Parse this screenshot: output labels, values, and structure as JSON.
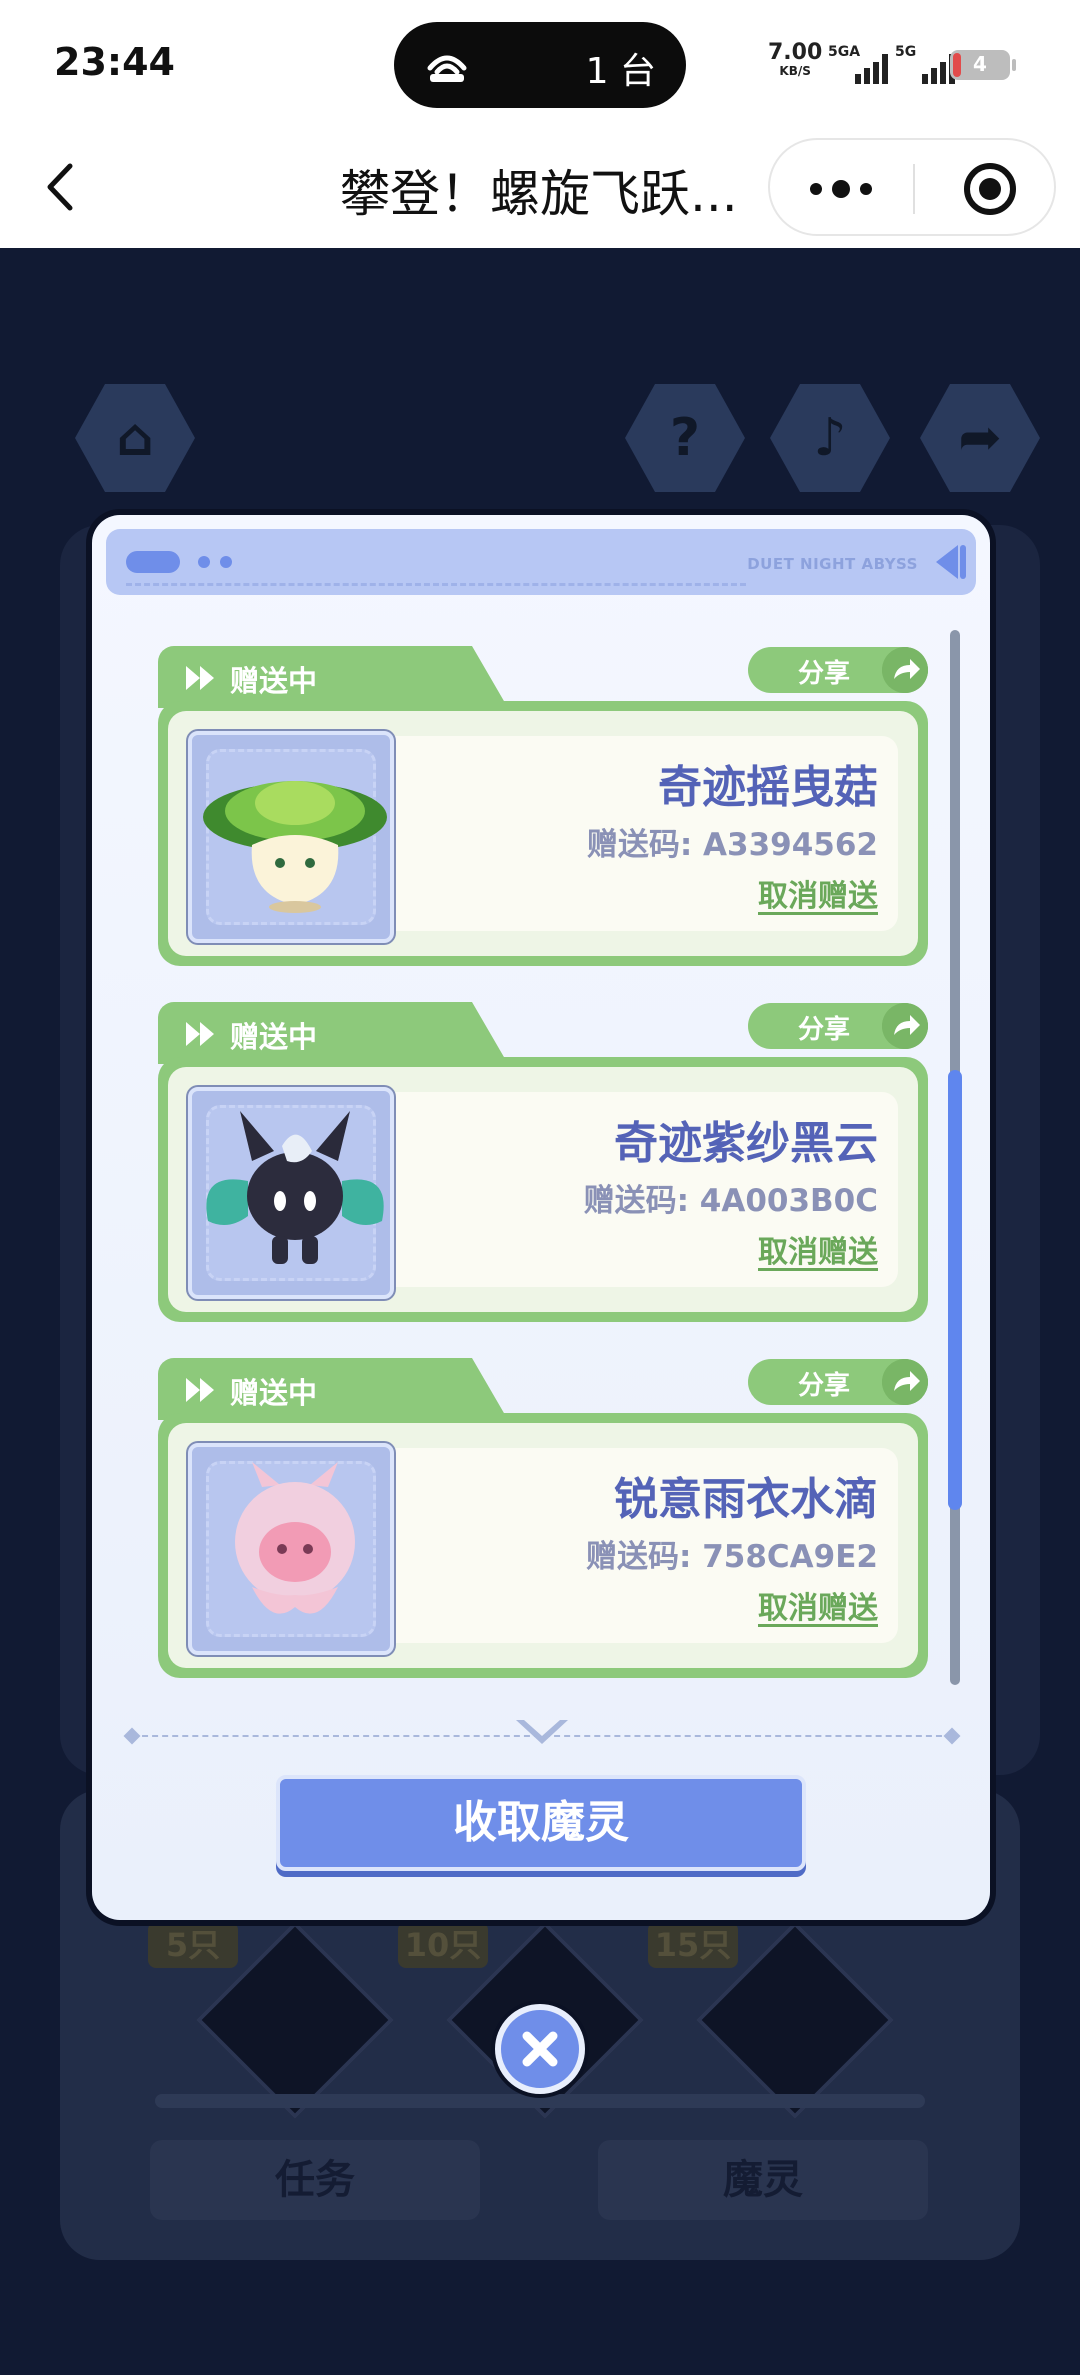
{
  "status_bar": {
    "time": "23:44",
    "hotspot_count": "1 台",
    "net_speed": "7.00",
    "net_unit": "KB/S",
    "signal1_label": "5GA",
    "signal2_label": "5G",
    "battery": "4"
  },
  "nav": {
    "title": "攀登！螺旋飞跃...",
    "back_icon": "chevron-left-icon",
    "more_icon": "more-dots-icon",
    "record_icon": "target-circle-icon"
  },
  "dialog": {
    "header_brand": "DUET NIGHT ABYSS",
    "cards": [
      {
        "status": "赠送中",
        "share": "分享",
        "name": "奇迹摇曳菇",
        "code": "赠送码: A3394562",
        "cancel": "取消赠送",
        "pet_icon": "mushroom-sprite-icon"
      },
      {
        "status": "赠送中",
        "share": "分享",
        "name": "奇迹紫纱黑云",
        "code": "赠送码: 4A003B0C",
        "cancel": "取消赠送",
        "pet_icon": "dark-cloud-sprite-icon"
      },
      {
        "status": "赠送中",
        "share": "分享",
        "name": "锐意雨衣水滴",
        "code": "赠送码: 758CA9E2",
        "cancel": "取消赠送",
        "pet_icon": "pink-droplet-sprite-icon"
      }
    ],
    "collect_button": "收取魔灵",
    "scroll_position": 0.45
  },
  "background": {
    "tags": [
      "5只",
      "10只",
      "15只"
    ],
    "tabs": [
      "任务",
      "魔灵"
    ],
    "top_icons": [
      "home-icon",
      "help-icon",
      "music-icon",
      "share-icon"
    ]
  },
  "colors": {
    "accent_blue": "#6f8ee9",
    "card_green": "#8dc97b",
    "name_purple": "#5463b7"
  }
}
